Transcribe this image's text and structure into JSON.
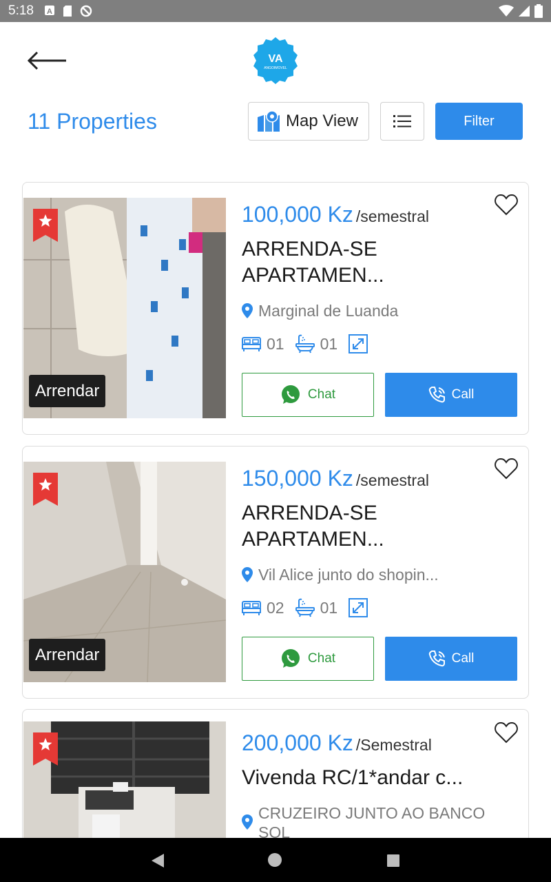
{
  "status_bar": {
    "time": "5:18"
  },
  "header": {
    "back_icon": "arrow-left-icon",
    "logo_text": "ANGOIMOVEL"
  },
  "toolbar": {
    "count_title": "11 Properties",
    "map_view_label": "Map View",
    "list_icon": "list-icon",
    "filter_label": "Filter"
  },
  "listings": [
    {
      "price": "100,000 Kz",
      "period": "/semestral",
      "title": "ARRENDA-SE APARTAMEN...",
      "location": "Marginal de Luanda",
      "bedrooms": "01",
      "bathrooms": "01",
      "badge": "Arrendar",
      "chat_label": "Chat",
      "call_label": "Call"
    },
    {
      "price": "150,000 Kz",
      "period": "/semestral",
      "title": "ARRENDA-SE APARTAMEN...",
      "location": "Vil Alice junto do shopin...",
      "bedrooms": "02",
      "bathrooms": "01",
      "badge": "Arrendar",
      "chat_label": "Chat",
      "call_label": "Call"
    },
    {
      "price": "200,000 Kz",
      "period": "/Semestral",
      "title": "Vivenda RC/1*andar c...",
      "location": "CRUZEIRO JUNTO AO BANCO SOL",
      "badge": "",
      "chat_label": "",
      "call_label": ""
    }
  ],
  "colors": {
    "primary": "#2e8bea",
    "whatsapp": "#2e9a3e",
    "ribbon": "#e53935"
  }
}
